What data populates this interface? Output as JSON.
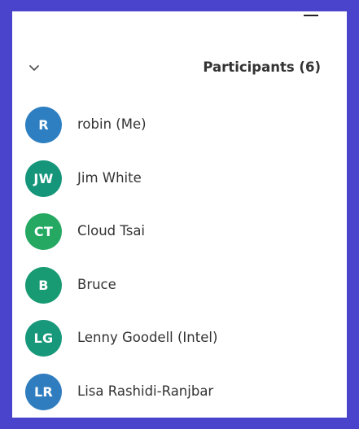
{
  "panel": {
    "title": "Participants (6)"
  },
  "participants": [
    {
      "initials": "R",
      "name": "robin (Me)",
      "color": "#2d7fc1"
    },
    {
      "initials": "JW",
      "name": "Jim White",
      "color": "#15957a"
    },
    {
      "initials": "CT",
      "name": "Cloud Tsai",
      "color": "#25a862"
    },
    {
      "initials": "B",
      "name": "Bruce",
      "color": "#189a72"
    },
    {
      "initials": "LG",
      "name": "Lenny Goodell (Intel)",
      "color": "#17987a"
    },
    {
      "initials": "LR",
      "name": "Lisa Rashidi-Ranjbar",
      "color": "#2f7dbf"
    }
  ],
  "icons": {
    "minimize": "minimize-icon",
    "collapse": "chevron-down-icon"
  }
}
